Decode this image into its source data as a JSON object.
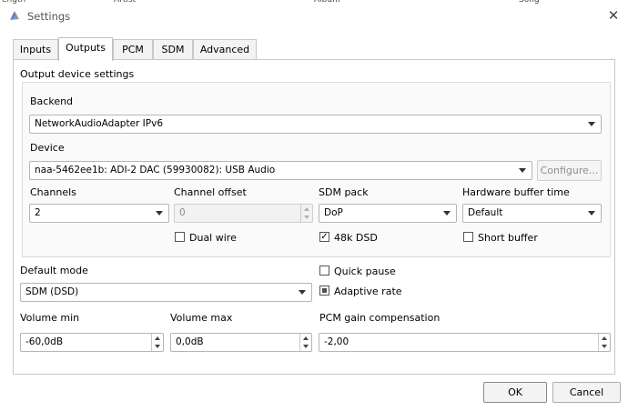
{
  "window": {
    "title": "Settings",
    "background_columns": [
      "ength",
      "Artist",
      "Album",
      "Song"
    ]
  },
  "tabs": [
    {
      "label": "Inputs",
      "active": false
    },
    {
      "label": "Outputs",
      "active": true
    },
    {
      "label": "PCM",
      "active": false
    },
    {
      "label": "SDM",
      "active": false
    },
    {
      "label": "Advanced",
      "active": false
    }
  ],
  "output_device": {
    "group_title": "Output device settings",
    "backend_label": "Backend",
    "backend_value": "NetworkAudioAdapter IPv6",
    "device_label": "Device",
    "device_value": "naa-5462ee1b: ADI-2 DAC (59930082): USB Audio",
    "configure_label": "Configure...",
    "channels_label": "Channels",
    "channels_value": "2",
    "channel_offset_label": "Channel offset",
    "channel_offset_value": "0",
    "sdm_pack_label": "SDM pack",
    "sdm_pack_value": "DoP",
    "hw_buffer_label": "Hardware buffer time",
    "hw_buffer_value": "Default",
    "dual_wire_label": "Dual wire",
    "dual_wire_checked": false,
    "dsd48k_label": "48k DSD",
    "dsd48k_checked": true,
    "short_buffer_label": "Short buffer",
    "short_buffer_checked": false
  },
  "general": {
    "default_mode_label": "Default mode",
    "default_mode_value": "SDM (DSD)",
    "quick_pause_label": "Quick pause",
    "quick_pause_checked": false,
    "adaptive_rate_label": "Adaptive rate",
    "adaptive_rate_state": "indeterminate",
    "volume_min_label": "Volume min",
    "volume_min_value": "-60,0dB",
    "volume_max_label": "Volume max",
    "volume_max_value": "0,0dB",
    "pcm_gain_label": "PCM gain compensation",
    "pcm_gain_value": "-2,00"
  },
  "buttons": {
    "ok": "OK",
    "cancel": "Cancel",
    "close_glyph": "✕",
    "check_glyph": "✓"
  }
}
